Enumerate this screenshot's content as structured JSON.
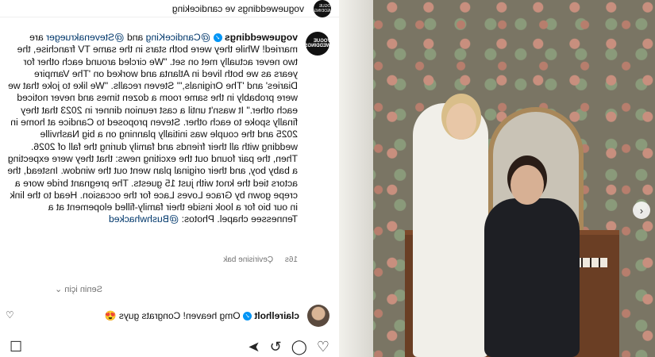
{
  "header": {
    "account": "vogueweddings",
    "breadcrumb": "vogueweddings ve candiceking",
    "avatar_text": "VOGUE WEDDINGS"
  },
  "caption": {
    "username": "vogueweddings",
    "mention1": "@CandiceKing",
    "conj": "and",
    "mention2": "@Stevenakrueger",
    "body": "are married! While they were both stars in the same TV franchise, the two never actually met on set. \"We circled around each other for years as we both lived in Atlanta and worked on 'The Vampire Diaries' and 'The Originals,'\" Steven recalls. \"We like to joke that we were probably in the same room a dozen times and never noticed each other.\" It wasn't until a cast reunion dinner in 2023 that they finally spoke to each other. Steven proposed to Candice at home in 2025 and the couple was initially planning on a big Nashville wedding with all their friends and family during the fall of 2026. Then, the pair found out the exciting news: that they were expecting a baby boy, and their original plan went out the window. Instead, the actors tied the knot with just 15 guests. The pregnant bride wore a crepe gown by Grace Loves Lace for the occasion. Head to the link in our bio for a look inside their family-filled elopement at a Tennessee chapel. Photos:",
    "photo_credit": "@Bushwhacked"
  },
  "meta": {
    "time": "16s",
    "see_translation": "Çevirisine bak"
  },
  "for_you": "Senin için",
  "comment": {
    "username": "clairelholt",
    "text": "Omg heaven! Congrats guys",
    "emoji": "😍"
  },
  "icons": [
    "heart-icon",
    "comment-icon",
    "repost-icon",
    "share-icon",
    "save-icon"
  ],
  "colors": {
    "link": "#00376b",
    "verified": "#0095f6"
  }
}
